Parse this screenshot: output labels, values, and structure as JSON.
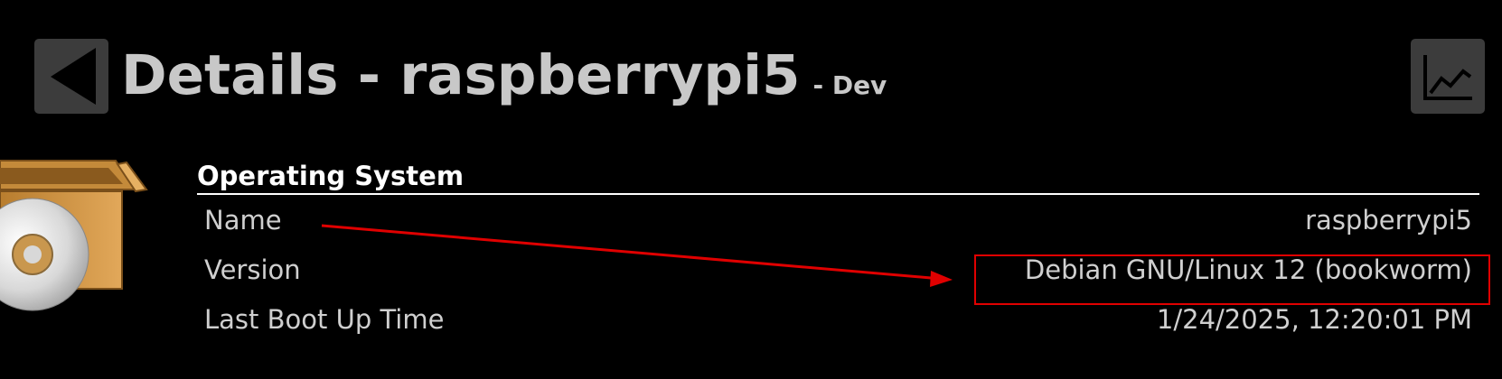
{
  "header": {
    "title": "Details - raspberrypi5",
    "subtitle": "- Dev",
    "back_icon": "back-arrow-icon",
    "chart_icon": "line-chart-icon"
  },
  "section": {
    "title": "Operating System",
    "icon": "package-install-icon",
    "rows": [
      {
        "label": "Name",
        "value": "raspberrypi5"
      },
      {
        "label": "Version",
        "value": "Debian GNU/Linux 12 (bookworm)"
      },
      {
        "label": "Last Boot Up Time",
        "value": "1/24/2025, 12:20:01 PM"
      }
    ]
  },
  "annotation": {
    "color": "#e00000"
  }
}
